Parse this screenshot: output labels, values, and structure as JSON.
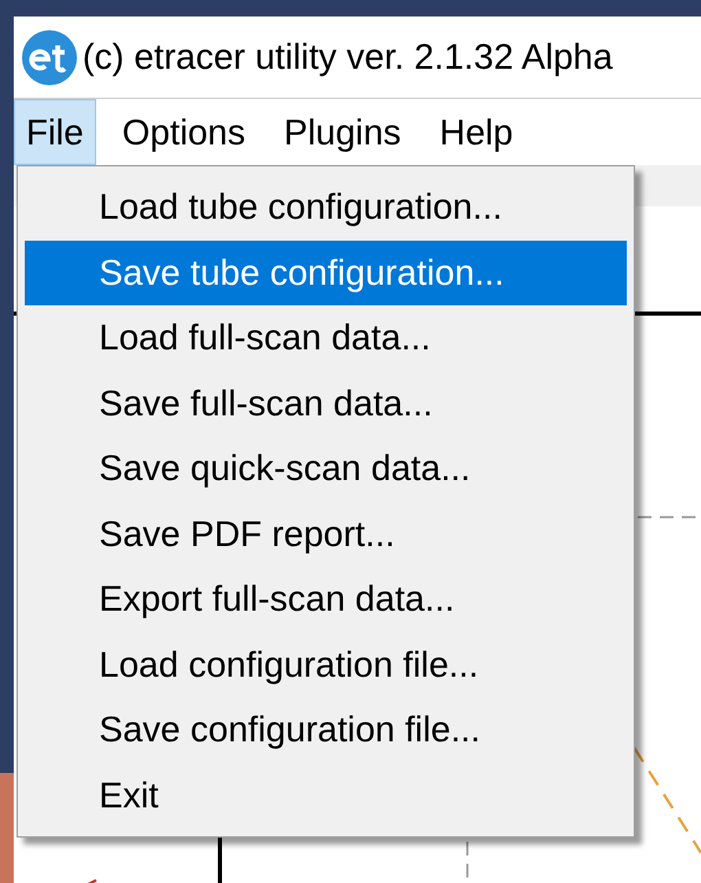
{
  "window": {
    "title": "(c) etracer utility ver. 2.1.32 Alpha"
  },
  "menu_bar": [
    {
      "label": "File",
      "selected": true
    },
    {
      "label": "Options",
      "selected": false
    },
    {
      "label": "Plugins",
      "selected": false
    },
    {
      "label": "Help",
      "selected": false
    }
  ],
  "file_menu": [
    {
      "label": "Load tube configuration...",
      "selected": false
    },
    {
      "label": "Save tube configuration...",
      "selected": true
    },
    {
      "label": "Load full-scan data...",
      "selected": false
    },
    {
      "label": "Save full-scan data...",
      "selected": false
    },
    {
      "label": "Save quick-scan data...",
      "selected": false
    },
    {
      "label": "Save PDF report...",
      "selected": false
    },
    {
      "label": "Export full-scan data...",
      "selected": false
    },
    {
      "label": "Load configuration file...",
      "selected": false
    },
    {
      "label": "Save configuration file...",
      "selected": false
    },
    {
      "label": "Exit",
      "selected": false
    }
  ]
}
